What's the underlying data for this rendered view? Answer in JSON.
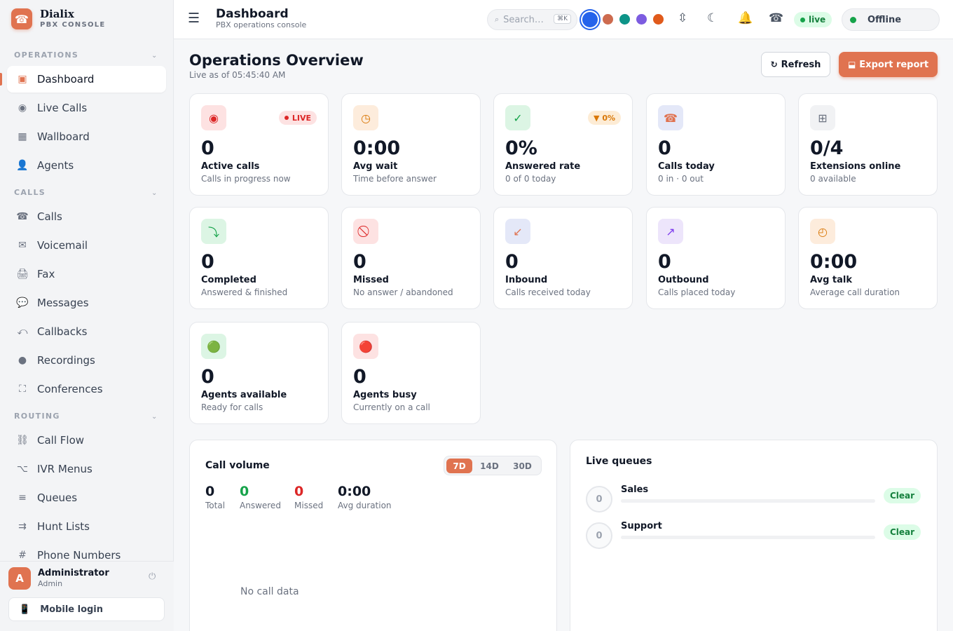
{
  "brand": {
    "name": "Dialix",
    "subtitle": "PBX CONSOLE",
    "logo_icon": "☎"
  },
  "sidebar": {
    "sections": [
      {
        "label": "OPERATIONS",
        "items": [
          {
            "label": "Dashboard",
            "icon": "▣",
            "icon_name": "dashboard-icon",
            "active": true
          },
          {
            "label": "Live Calls",
            "icon": "◉",
            "icon_name": "live-calls-icon"
          },
          {
            "label": "Wallboard",
            "icon": "▦",
            "icon_name": "wallboard-icon"
          },
          {
            "label": "Agents",
            "icon": "👤",
            "icon_name": "agents-icon"
          }
        ]
      },
      {
        "label": "CALLS",
        "items": [
          {
            "label": "Calls",
            "icon": "☎",
            "icon_name": "phone-icon"
          },
          {
            "label": "Voicemail",
            "icon": "✉",
            "icon_name": "voicemail-icon"
          },
          {
            "label": "Fax",
            "icon": "🖨",
            "icon_name": "fax-icon"
          },
          {
            "label": "Messages",
            "icon": "💬",
            "icon_name": "messages-icon"
          },
          {
            "label": "Callbacks",
            "icon": "⤺",
            "icon_name": "callbacks-icon"
          },
          {
            "label": "Recordings",
            "icon": "●",
            "icon_name": "recordings-icon"
          },
          {
            "label": "Conferences",
            "icon": "⛶",
            "icon_name": "conferences-icon"
          }
        ]
      },
      {
        "label": "ROUTING",
        "items": [
          {
            "label": "Call Flow",
            "icon": "⛓",
            "icon_name": "call-flow-icon"
          },
          {
            "label": "IVR Menus",
            "icon": "⌥",
            "icon_name": "ivr-menus-icon"
          },
          {
            "label": "Queues",
            "icon": "≡",
            "icon_name": "queues-icon"
          },
          {
            "label": "Hunt Lists",
            "icon": "⇉",
            "icon_name": "hunt-lists-icon"
          },
          {
            "label": "Phone Numbers",
            "icon": "#",
            "icon_name": "phone-numbers-icon"
          }
        ]
      }
    ],
    "chevron": "⌄"
  },
  "user": {
    "initial": "A",
    "name": "Administrator",
    "role": "Admin",
    "power_icon": "⏻",
    "mobile_label": "Mobile login",
    "mobile_icon": "📱"
  },
  "topbar": {
    "menu_icon": "☰",
    "title": "Dashboard",
    "subtitle": "PBX operations console",
    "search_placeholder": "Search…",
    "search_icon": "⌕",
    "search_shortcut": "⌘K",
    "theme_swatches": [
      "#2563eb",
      "#cd6b4f",
      "#0d9488",
      "#7c5ce0",
      "#e05a1b"
    ],
    "density_icon": "⇳",
    "dark_mode_icon": "☾",
    "bell_icon": "🔔",
    "phone_icon": "☎",
    "live_label": "live",
    "status_label": "Offline"
  },
  "overview": {
    "title": "Operations Overview",
    "subtitle": "Live as of 05:45:40 AM",
    "refresh_label": "Refresh",
    "refresh_icon": "↻",
    "export_label": "Export report",
    "export_icon": "⬓"
  },
  "cards": [
    {
      "icon": "◉",
      "icon_name": "live-icon",
      "icon_bg": "#fde2e2",
      "icon_color": "#dc2626",
      "value": "0",
      "label": "Active calls",
      "desc": "Calls in progress now",
      "badge": "LIVE",
      "badge_bg": "#fde2e2",
      "badge_color": "#dc2626",
      "badge_dot": true
    },
    {
      "icon": "◷",
      "icon_name": "clock-icon",
      "icon_bg": "#fdecdc",
      "icon_color": "#d97706",
      "value": "0:00",
      "label": "Avg wait",
      "desc": "Time before answer"
    },
    {
      "icon": "✓",
      "icon_name": "check-icon",
      "icon_bg": "#dcf5e4",
      "icon_color": "#16a34a",
      "value": "0%",
      "label": "Answered rate",
      "desc": "0 of 0 today",
      "badge": "▼ 0%",
      "badge_bg": "#fdecd5",
      "badge_color": "#d97706"
    },
    {
      "icon": "☎",
      "icon_name": "phone-icon",
      "icon_bg": "#e4e8f8",
      "icon_color": "#e07350",
      "value": "0",
      "label": "Calls today",
      "desc": "0 in · 0 out"
    },
    {
      "icon": "⊞",
      "icon_name": "grid-icon",
      "icon_bg": "#f1f2f4",
      "icon_color": "#6b7280",
      "value": "0/4",
      "label": "Extensions online",
      "desc": "0 available"
    },
    {
      "icon": "⤵",
      "icon_name": "completed-icon",
      "icon_bg": "#dcf5e4",
      "icon_color": "#16a34a",
      "value": "0",
      "label": "Completed",
      "desc": "Answered & finished"
    },
    {
      "icon": "⃠",
      "icon_name": "blocked-icon",
      "icon_bg": "#fde2e2",
      "icon_color": "#dc2626",
      "value": "0",
      "label": "Missed",
      "desc": "No answer / abandoned"
    },
    {
      "icon": "↙",
      "icon_name": "inbound-arrow-icon",
      "icon_bg": "#e4e8f8",
      "icon_color": "#e07350",
      "value": "0",
      "label": "Inbound",
      "desc": "Calls received today"
    },
    {
      "icon": "↗",
      "icon_name": "outbound-arrow-icon",
      "icon_bg": "#ede5fb",
      "icon_color": "#7c3aed",
      "value": "0",
      "label": "Outbound",
      "desc": "Calls placed today"
    },
    {
      "icon": "◴",
      "icon_name": "timer-icon",
      "icon_bg": "#fdecdc",
      "icon_color": "#d97706",
      "value": "0:00",
      "label": "Avg talk",
      "desc": "Average call duration"
    },
    {
      "icon": "🟢",
      "icon_name": "available-icon",
      "icon_bg": "#dcf5e4",
      "icon_color": "#16a34a",
      "value": "0",
      "label": "Agents available",
      "desc": "Ready for calls"
    },
    {
      "icon": "🔴",
      "icon_name": "busy-icon",
      "icon_bg": "#fde2e2",
      "icon_color": "#dc2626",
      "value": "0",
      "label": "Agents busy",
      "desc": "Currently on a call"
    }
  ],
  "call_volume": {
    "title": "Call volume",
    "ranges": [
      "7D",
      "14D",
      "30D"
    ],
    "active_range": "7D",
    "stats": [
      {
        "value": "0",
        "label": "Total",
        "color": "#111827"
      },
      {
        "value": "0",
        "label": "Answered",
        "color": "#16a34a"
      },
      {
        "value": "0",
        "label": "Missed",
        "color": "#dc2626"
      },
      {
        "value": "0:00",
        "label": "Avg duration",
        "color": "#111827"
      }
    ],
    "empty_text": "No call data"
  },
  "live_queues": {
    "title": "Live queues",
    "queues": [
      {
        "name": "Sales",
        "count": "0",
        "status": "Clear"
      },
      {
        "name": "Support",
        "count": "0",
        "status": "Clear"
      }
    ]
  }
}
